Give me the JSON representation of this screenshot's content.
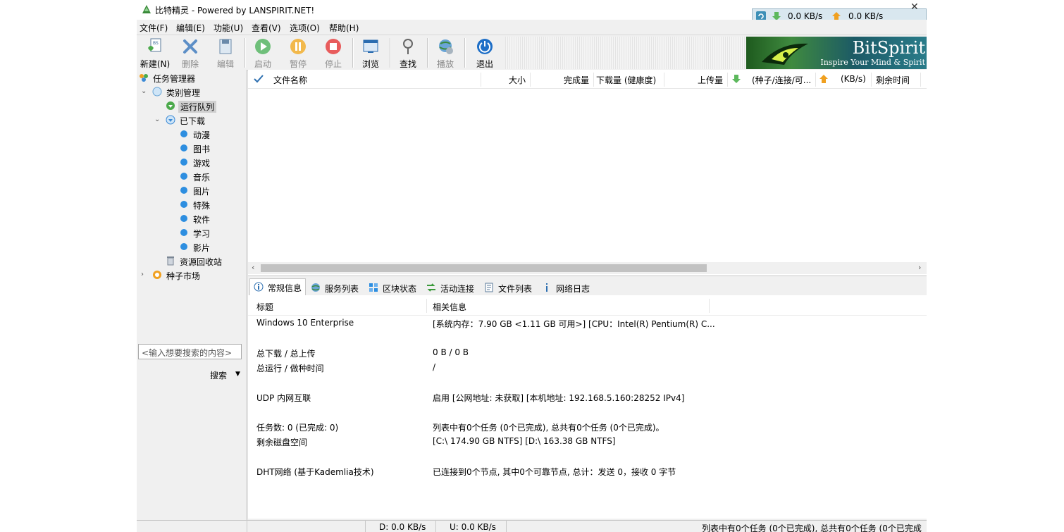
{
  "window": {
    "title": "比特精灵 - Powered by LANSPIRIT.NET!",
    "download_speed": "0.0 KB/s",
    "upload_speed": "0.0 KB/s",
    "close_glyph": "✕"
  },
  "menu": [
    "文件(F)",
    "编辑(E)",
    "功能(U)",
    "查看(V)",
    "选项(O)",
    "帮助(H)"
  ],
  "toolbar": {
    "new": "新建(N)",
    "delete": "删除",
    "edit": "编辑",
    "start": "启动",
    "pause": "暂停",
    "stop": "停止",
    "browse": "浏览",
    "find": "查找",
    "play": "播放",
    "exit": "退出"
  },
  "banner": {
    "brand": "BitSpirit",
    "tagline": "Inspire Your Mind & Spirit"
  },
  "tree": {
    "root": "任务管理器",
    "category": "类别管理",
    "running": "运行队列",
    "downloaded": "已下载",
    "children": [
      "动漫",
      "图书",
      "游戏",
      "音乐",
      "图片",
      "特殊",
      "软件",
      "学习",
      "影片"
    ],
    "recycle": "资源回收站",
    "market": "种子市场"
  },
  "search": {
    "placeholder": "<输入想要搜索的内容>",
    "button": "搜索"
  },
  "list_columns": {
    "name": "文件名称",
    "size": "大小",
    "done": "完成量",
    "downloaded": "下载量 (健康度)",
    "uploaded": "上传量",
    "seeds": "(种子/连接/可...",
    "speed": "(KB/s)",
    "remaining": "剩余时间"
  },
  "tabs": [
    "常规信息",
    "服务列表",
    "区块状态",
    "活动连接",
    "文件列表",
    "网络日志"
  ],
  "info": {
    "header_key": "标题",
    "header_value": "相关信息",
    "rows": [
      {
        "k": "Windows 10 Enterprise",
        "v": "[系统内存：7.90 GB <1.11 GB 可用>] [CPU：Intel(R) Pentium(R) C..."
      },
      {
        "k": "总下载 / 总上传",
        "v": "0 B / 0 B"
      },
      {
        "k": "总运行 / 做种时间",
        "v": " /"
      },
      {
        "k": "UDP 内网互联",
        "v": "启用 [公网地址: 未获取] [本机地址: 192.168.5.160:28252 IPv4]"
      },
      {
        "k": "任务数: 0 (已完成: 0)",
        "v": "列表中有0个任务 (0个已完成), 总共有0个任务 (0个已完成)。"
      },
      {
        "k": "剩余磁盘空间",
        "v": "[C:\\ 174.90 GB  NTFS]  [D:\\ 163.38 GB  NTFS]"
      },
      {
        "k": "DHT网络 (基于Kademlia技术)",
        "v": "已连接到0个节点, 其中0个可靠节点, 总计：发送 0，接收 0 字节"
      }
    ]
  },
  "status": {
    "down": "D: 0.0 KB/s",
    "up": "U: 0.0 KB/s",
    "summary": "列表中有0个任务 (0个已完成), 总共有0个任务 (0个已完成"
  }
}
